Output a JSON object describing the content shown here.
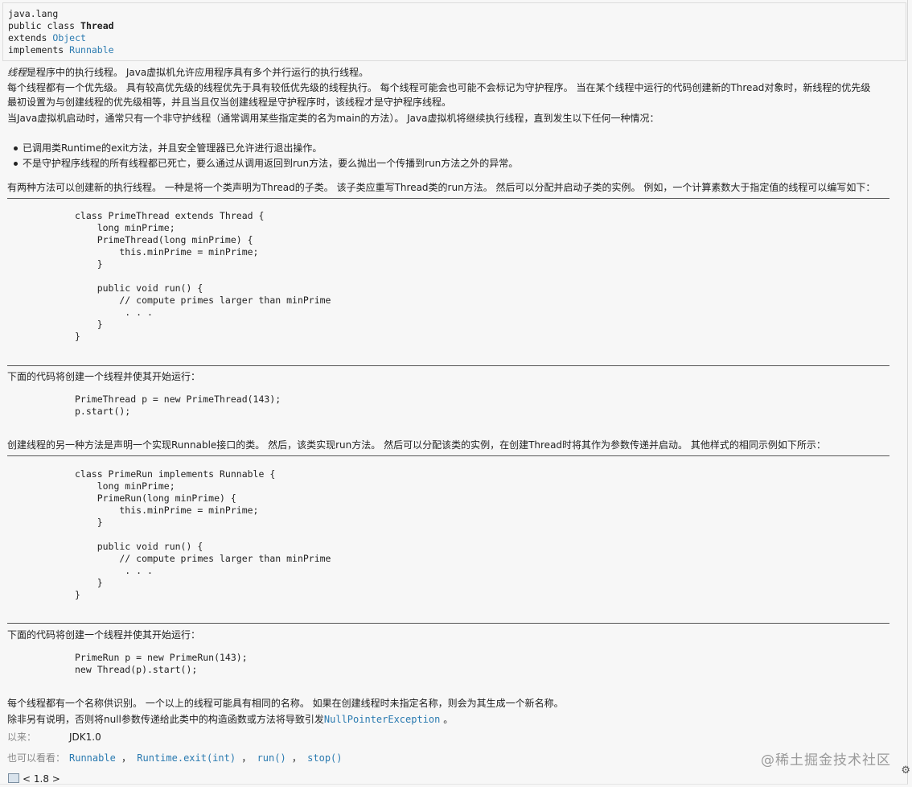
{
  "header": {
    "package": "java.lang",
    "class_prefix": "public class ",
    "class_name": "Thread",
    "extends_kw": "extends ",
    "extends_link": "Object",
    "implements_kw": "implements ",
    "implements_link": "Runnable"
  },
  "desc": {
    "p1_em": "线程",
    "p1_rest": "是程序中的执行线程。 Java虚拟机允许应用程序具有多个并行运行的执行线程。",
    "p2a": "每个线程都有一个优先级。 具有较高优先级的线程优先于具有较低优先级的线程执行。 每个线程可能会也可能不会标记为守护程序。 当在某个线程中运行的代码创建新的Thread对象时，新线程的优先级",
    "p2b": "最初设置为与创建线程的优先级相等，并且当且仅当创建线程是守护程序时，该线程才是守护程序线程。",
    "p3": "当Java虚拟机启动时，通常只有一个非守护线程（通常调用某些指定类的名为main的方法）。 Java虚拟机将继续执行线程，直到发生以下任何一种情况：",
    "bullets": [
      "已调用类Runtime的exit方法，并且安全管理器已允许进行退出操作。",
      "不是守护程序线程的所有线程都已死亡，要么通过从调用返回到run方法，要么抛出一个传播到run方法之外的异常。"
    ],
    "p4": "有两种方法可以创建新的执行线程。 一种是将一个类声明为Thread的子类。 该子类应重写Thread类的run方法。 然后可以分配并启动子类的实例。 例如，一个计算素数大于指定值的线程可以编写如下：",
    "code1": "class PrimeThread extends Thread {\n    long minPrime;\n    PrimeThread(long minPrime) {\n        this.minPrime = minPrime;\n    }\n\n    public void run() {\n        // compute primes larger than minPrime\n         . . .\n    }\n}",
    "p5": "下面的代码将创建一个线程并使其开始运行：",
    "code2": "PrimeThread p = new PrimeThread(143);\np.start();",
    "p6": "创建线程的另一种方法是声明一个实现Runnable接口的类。 然后，该类实现run方法。 然后可以分配该类的实例，在创建Thread时将其作为参数传递并启动。 其他样式的相同示例如下所示：",
    "code3": "class PrimeRun implements Runnable {\n    long minPrime;\n    PrimeRun(long minPrime) {\n        this.minPrime = minPrime;\n    }\n\n    public void run() {\n        // compute primes larger than minPrime\n         . . .\n    }\n}",
    "p7": "下面的代码将创建一个线程并使其开始运行：",
    "code4": "PrimeRun p = new PrimeRun(143);\nnew Thread(p).start();",
    "p8": "每个线程都有一个名称供识别。 一个以上的线程可能具有相同的名称。 如果在创建线程时未指定名称，则会为其生成一个新名称。",
    "p9_pre": "除非另有说明，否则将null参数传递给此类中的构造函数或方法将导致引发",
    "p9_link": "NullPointerException",
    "p9_post": " 。"
  },
  "meta": {
    "since_label": "以来：",
    "since_value": "JDK1.0",
    "see_label": "也可以看看：",
    "see_links": [
      "Runnable",
      "Runtime.exit(int)",
      "run()",
      "stop()"
    ],
    "sep": " ，"
  },
  "footer": {
    "version": "< 1.8 >",
    "watermark": "@稀土掘金技术社区"
  }
}
